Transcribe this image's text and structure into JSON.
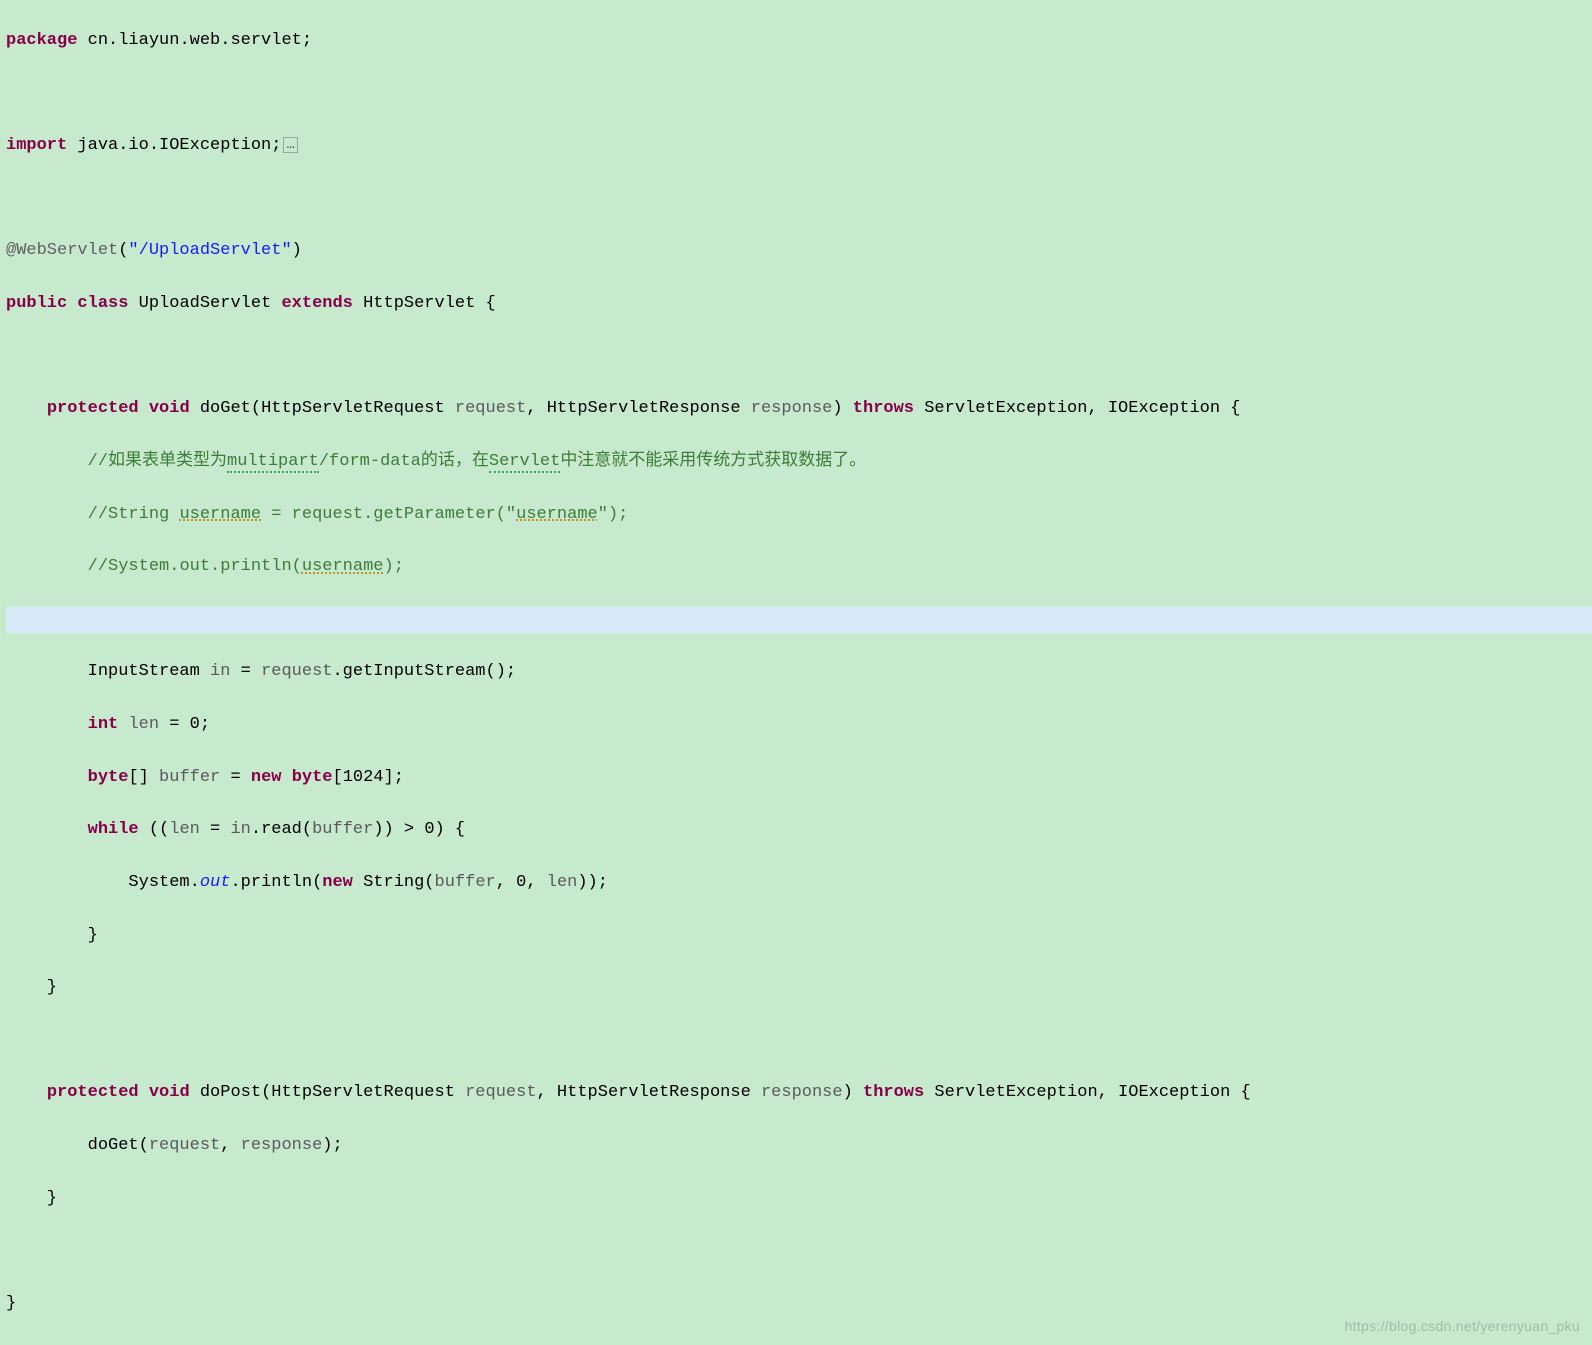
{
  "code": {
    "l1_kw_package": "package",
    "l1_pkg": " cn.liayun.web.servlet;",
    "l3_kw_import": "import",
    "l3_imp": " java.io.IOException;",
    "l3_foldbox": "…",
    "l5_ann": "@WebServlet",
    "l5_paren_open": "(",
    "l5_str": "\"/UploadServlet\"",
    "l5_paren_close": ")",
    "l6_kw_public": "public",
    "l6_kw_class": "class",
    "l6_name": " UploadServlet ",
    "l6_kw_extends": "extends",
    "l6_super": " HttpServlet {",
    "l8_indent": "    ",
    "l8_kw_protected": "protected",
    "l8_kw_void": " void",
    "l8_method": " doGet(HttpServletRequest ",
    "l8_p1": "request",
    "l8_sep1": ", HttpServletResponse ",
    "l8_p2": "response",
    "l8_sep2": ") ",
    "l8_kw_throws": "throws",
    "l8_exc": " ServletException, IOException {",
    "l9_indent": "        ",
    "l9_cmt_a": "//如果表单类型为",
    "l9_cmt_b": "multipart",
    "l9_cmt_c": "/form-data的话，在",
    "l9_cmt_d": "Servlet",
    "l9_cmt_e": "中注意就不能采用传统方式获取数据了。",
    "l10_cmt_a": "//String ",
    "l10_cmt_b": "username",
    "l10_cmt_c": " = request.getParameter(\"",
    "l10_cmt_d": "username",
    "l10_cmt_e": "\");",
    "l11_cmt_a": "//System.out.println(",
    "l11_cmt_b": "username",
    "l11_cmt_c": ");",
    "l13_a": "        InputStream ",
    "l13_in": "in",
    "l13_b": " = ",
    "l13_req": "request",
    "l13_c": ".getInputStream();",
    "l14_a": "        ",
    "l14_kw_int": "int",
    "l14_b": " ",
    "l14_len": "len",
    "l14_c": " = 0;",
    "l15_a": "        ",
    "l15_kw_byte": "byte",
    "l15_b": "[] ",
    "l15_buf": "buffer",
    "l15_c": " = ",
    "l15_kw_new": "new",
    "l15_d": " ",
    "l15_kw_byte2": "byte",
    "l15_e": "[1024];",
    "l16_a": "        ",
    "l16_kw_while": "while",
    "l16_b": " ((",
    "l16_len": "len",
    "l16_c": " = ",
    "l16_in": "in",
    "l16_d": ".read(",
    "l16_buf": "buffer",
    "l16_e": ")) > 0) {",
    "l17_a": "            System.",
    "l17_out": "out",
    "l17_b": ".println(",
    "l17_kw_new": "new",
    "l17_c": " String(",
    "l17_buf": "buffer",
    "l17_d": ", 0, ",
    "l17_len": "len",
    "l17_e": "));",
    "l18": "        }",
    "l19": "    }",
    "l21_indent": "    ",
    "l21_kw_protected": "protected",
    "l21_kw_void": " void",
    "l21_method": " doPost(HttpServletRequest ",
    "l21_p1": "request",
    "l21_sep1": ", HttpServletResponse ",
    "l21_p2": "response",
    "l21_sep2": ") ",
    "l21_kw_throws": "throws",
    "l21_exc": " ServletException, IOException {",
    "l22_a": "        doGet(",
    "l22_req": "request",
    "l22_b": ", ",
    "l22_resp": "response",
    "l22_c": ");",
    "l23": "    }",
    "l25": "}"
  },
  "watermark": "https://blog.csdn.net/yerenyuan_pku"
}
